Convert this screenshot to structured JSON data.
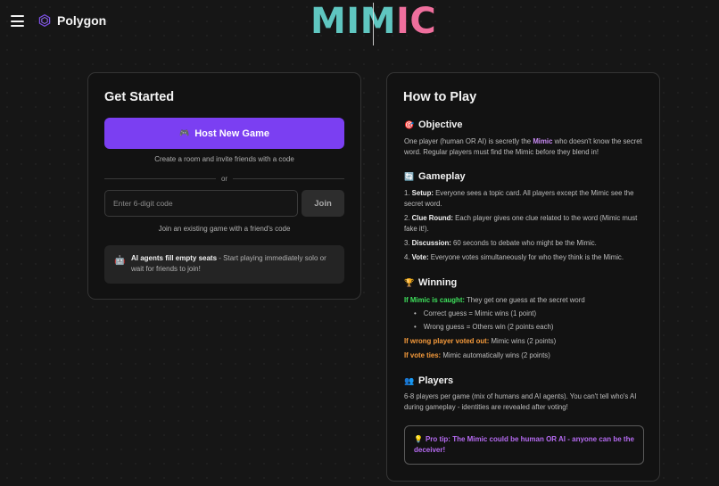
{
  "header": {
    "brand_name": "Polygon",
    "logo_part1": "MIM",
    "logo_part2": "IC"
  },
  "get_started": {
    "title": "Get Started",
    "host_button_emoji": "🎮",
    "host_button_label": "Host New Game",
    "host_hint": "Create a room and invite friends with a code",
    "divider_label": "or",
    "code_placeholder": "Enter 6-digit code",
    "code_value": "",
    "join_button_label": "Join",
    "join_hint": "Join an existing game with a friend's code",
    "ai_notice_emoji": "🤖",
    "ai_notice_strong": "AI agents fill empty seats",
    "ai_notice_text": " - Start playing immediately solo or wait for friends to join!"
  },
  "how_to_play": {
    "title": "How to Play",
    "objective": {
      "emoji": "🎯",
      "title": "Objective",
      "text_before": "One player (human OR AI) is secretly the ",
      "mimic_word": "Mimic",
      "text_after": " who doesn't know the secret word. Regular players must find the Mimic before they blend in!"
    },
    "gameplay": {
      "emoji": "🔄",
      "title": "Gameplay",
      "steps": [
        {
          "num": "1. ",
          "label": "Setup:",
          "text": " Everyone sees a topic card. All players except the Mimic see the secret word."
        },
        {
          "num": "2. ",
          "label": "Clue Round:",
          "text": " Each player gives one clue related to the word (Mimic must fake it!)."
        },
        {
          "num": "3. ",
          "label": "Discussion:",
          "text": " 60 seconds to debate who might be the Mimic."
        },
        {
          "num": "4. ",
          "label": "Vote:",
          "text": " Everyone votes simultaneously for who they think is the Mimic."
        }
      ]
    },
    "winning": {
      "emoji": "🏆",
      "title": "Winning",
      "caught_label": "If Mimic is caught:",
      "caught_text": " They get one guess at the secret word",
      "bullets": [
        "Correct guess = Mimic wins (1 point)",
        "Wrong guess = Others win (2 points each)"
      ],
      "wrong_label": "If wrong player voted out:",
      "wrong_text": " Mimic wins (2 points)",
      "tie_label": "If vote ties:",
      "tie_text": " Mimic automatically wins (2 points)"
    },
    "players": {
      "emoji": "👥",
      "title": "Players",
      "text": "6-8 players per game (mix of humans and AI agents). You can't tell who's AI during gameplay - identities are revealed after voting!"
    },
    "tip": {
      "emoji": "💡",
      "text": "Pro tip: The Mimic could be human OR AI - anyone can be the deceiver!"
    }
  },
  "colors": {
    "accent": "#7b3ff2",
    "logo_teal": "#5fc6c0",
    "logo_pink": "#ef6f9d",
    "caught_green": "#3ee05c",
    "warning_orange": "#f59a3b",
    "tip_purple": "#b66bf2"
  },
  "icons": {
    "menu": "hamburger-icon",
    "brand": "polygon-icon"
  }
}
